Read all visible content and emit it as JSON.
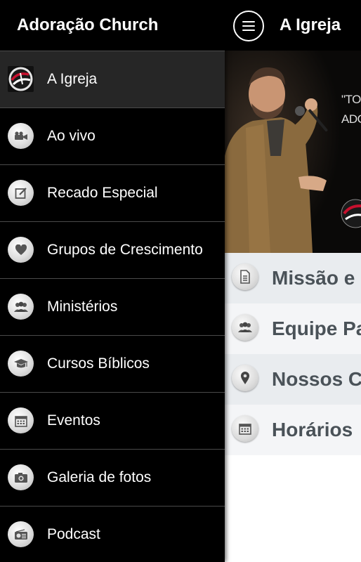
{
  "drawer": {
    "title": "Adoração Church",
    "items": [
      {
        "label": "A Igreja",
        "icon": "church-logo-icon",
        "active": true
      },
      {
        "label": "Ao vivo",
        "icon": "video-camera-icon"
      },
      {
        "label": "Recado Especial",
        "icon": "edit-note-icon"
      },
      {
        "label": "Grupos de Crescimento",
        "icon": "heart-icon"
      },
      {
        "label": "Ministérios",
        "icon": "group-icon"
      },
      {
        "label": "Cursos Bíblicos",
        "icon": "graduation-cap-icon"
      },
      {
        "label": "Eventos",
        "icon": "calendar-icon"
      },
      {
        "label": "Galeria de fotos",
        "icon": "camera-icon"
      },
      {
        "label": "Podcast",
        "icon": "radio-icon"
      }
    ]
  },
  "main": {
    "title": "A Igreja",
    "hero": {
      "quote_line1": "\"TO",
      "quote_line2": "ADOR"
    },
    "items": [
      {
        "label": "Missão e",
        "icon": "document-icon"
      },
      {
        "label": "Equipe Pa",
        "icon": "group-icon"
      },
      {
        "label": "Nossos C",
        "icon": "map-pin-icon"
      },
      {
        "label": "Horários",
        "icon": "calendar-icon"
      }
    ]
  },
  "colors": {
    "drawer_bg": "#000000",
    "active_item_bg": "#262626",
    "divider": "#4a4a4a",
    "content_text": "#4a5258",
    "brand_red": "#c8102e"
  }
}
